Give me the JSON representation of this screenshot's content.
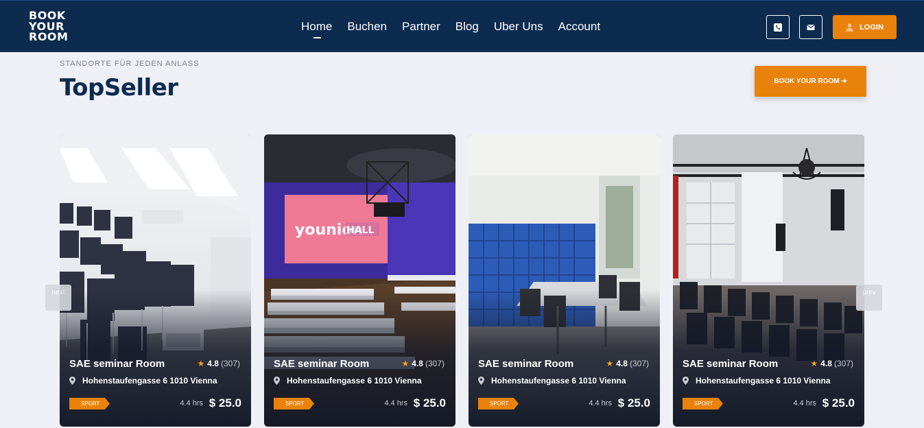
{
  "header": {
    "logo_lines": [
      "BOOK",
      "YOUR",
      "ROOM"
    ],
    "nav": [
      "Home",
      "Buchen",
      "Partner",
      "Blog",
      "Uber Uns",
      "Account"
    ],
    "login_label": "LOGIN",
    "icons": [
      "phone-icon",
      "envelope-icon",
      "user-icon"
    ]
  },
  "section": {
    "eyebrow": "STANDORTE FÜR JEDEN ANLASS",
    "title": "TopSeller",
    "cta_label": "BOOK YOUR ROOM ➔"
  },
  "carousel": {
    "next_label": "next",
    "prev_label": "prev",
    "cards": [
      {
        "name": "SAE seminar Room",
        "rating": "4.8",
        "reviews": "(307)",
        "address": "Hohenstaufengasse 6 1010 Vienna",
        "tag": "SPORT",
        "duration": "4.4 hrs",
        "price": "$ 25.0"
      },
      {
        "name": "SAE seminar Room",
        "rating": "4.8",
        "reviews": "(307)",
        "address": "Hohenstaufengasse 6 1010 Vienna",
        "tag": "SPORT",
        "duration": "4.4 hrs",
        "price": "$ 25.0",
        "screen_text": "younion HALL"
      },
      {
        "name": "SAE seminar Room",
        "rating": "4.8",
        "reviews": "(307)",
        "address": "Hohenstaufengasse 6 1010 Vienna",
        "tag": "SPORT",
        "duration": "4.4 hrs",
        "price": "$ 25.0"
      },
      {
        "name": "SAE seminar Room",
        "rating": "4.8",
        "reviews": "(307)",
        "address": "Hohenstaufengasse 6 1010 Vienna",
        "tag": "SPORT",
        "duration": "4.4 hrs",
        "price": "$ 25.0"
      }
    ]
  },
  "colors": {
    "header_bg": "#0d2b4f",
    "accent": "#e9820a",
    "page_bg": "#eef0f6",
    "title": "#0d2b4f"
  }
}
